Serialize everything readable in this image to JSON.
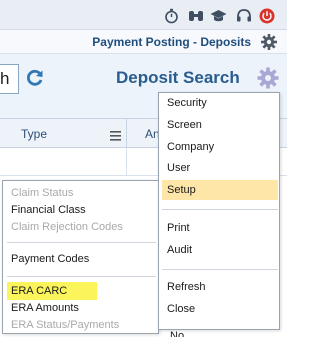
{
  "header": {
    "page_title": "Payment Posting - Deposits",
    "icons": [
      "stopwatch-icon",
      "binoculars-icon",
      "graduation-cap-icon",
      "headset-icon",
      "power-icon"
    ]
  },
  "search": {
    "input_value": "h",
    "title": "Deposit Search"
  },
  "table": {
    "columns": [
      "Type",
      "An"
    ]
  },
  "left_menu": {
    "items": [
      {
        "label": "Claim Status",
        "disabled": true
      },
      {
        "label": "Financial Class",
        "disabled": false
      },
      {
        "label": "Claim Rejection Codes",
        "disabled": true
      },
      {
        "label": "Payment Codes",
        "disabled": false
      },
      {
        "label": "ERA CARC",
        "disabled": false,
        "highlighted": true
      },
      {
        "label": "ERA Amounts",
        "disabled": false
      },
      {
        "label": "ERA Status/Payments",
        "disabled": true
      }
    ]
  },
  "right_menu": {
    "items": [
      {
        "label": "Security"
      },
      {
        "label": "Screen"
      },
      {
        "label": "Company"
      },
      {
        "label": "User"
      },
      {
        "label": "Setup",
        "highlighted": true
      },
      {
        "label": "Print"
      },
      {
        "label": "Audit"
      },
      {
        "label": "Refresh"
      },
      {
        "label": "Close"
      }
    ]
  },
  "partial_bottom_text": "No",
  "colors": {
    "title_blue": "#1f4e7d",
    "menu_highlight_yellow": "#fbf45b",
    "setup_highlight": "#fde6a8",
    "power_red": "#d9342b"
  }
}
